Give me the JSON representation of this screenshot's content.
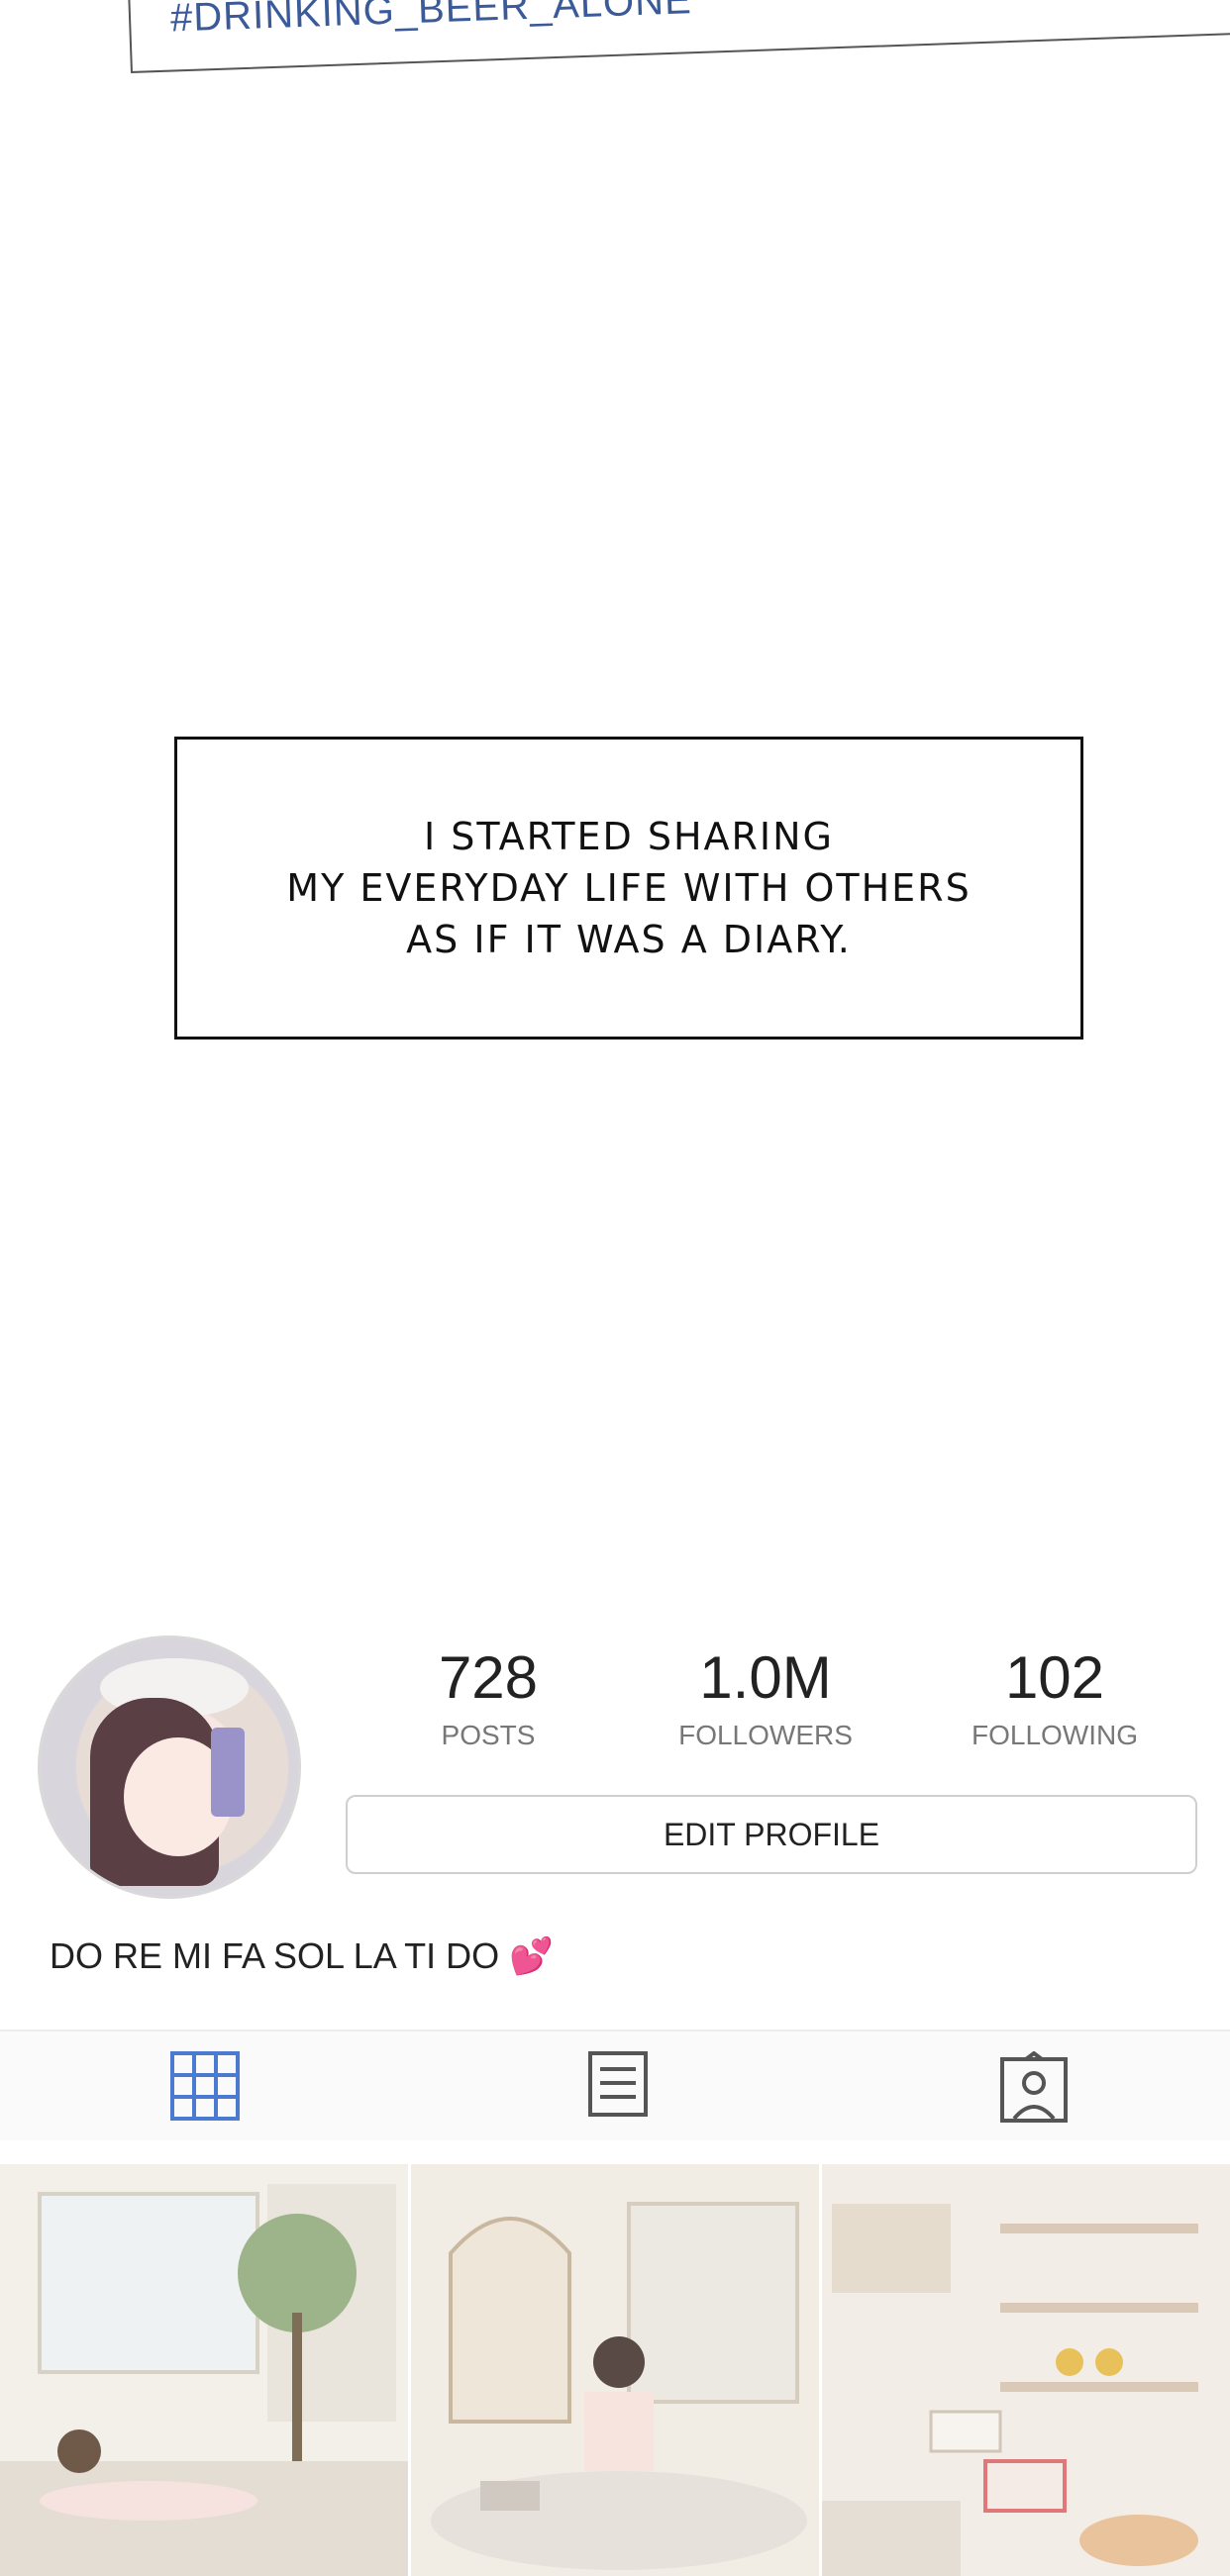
{
  "hashtag": "#DRINKING_BEER_ALONE",
  "caption": {
    "lines": [
      "I STARTED SHARING",
      "MY EVERYDAY LIFE WITH OTHERS",
      "AS IF IT WAS A DIARY."
    ]
  },
  "profile": {
    "stats": [
      {
        "value": "728",
        "label": "POSTS"
      },
      {
        "value": "1.0M",
        "label": "FOLLOWERS"
      },
      {
        "value": "102",
        "label": "FOLLOWING"
      }
    ],
    "edit_label": "EDIT PROFILE",
    "bio": "DO RE MI FA SOL LA TI DO",
    "bio_emoji": "💕"
  },
  "tabs": [
    {
      "icon": "grid-icon",
      "active": true
    },
    {
      "icon": "list-icon",
      "active": false
    },
    {
      "icon": "tagged-icon",
      "active": false
    }
  ],
  "colors": {
    "accent": "#4a7bd0",
    "muted": "#777777"
  }
}
